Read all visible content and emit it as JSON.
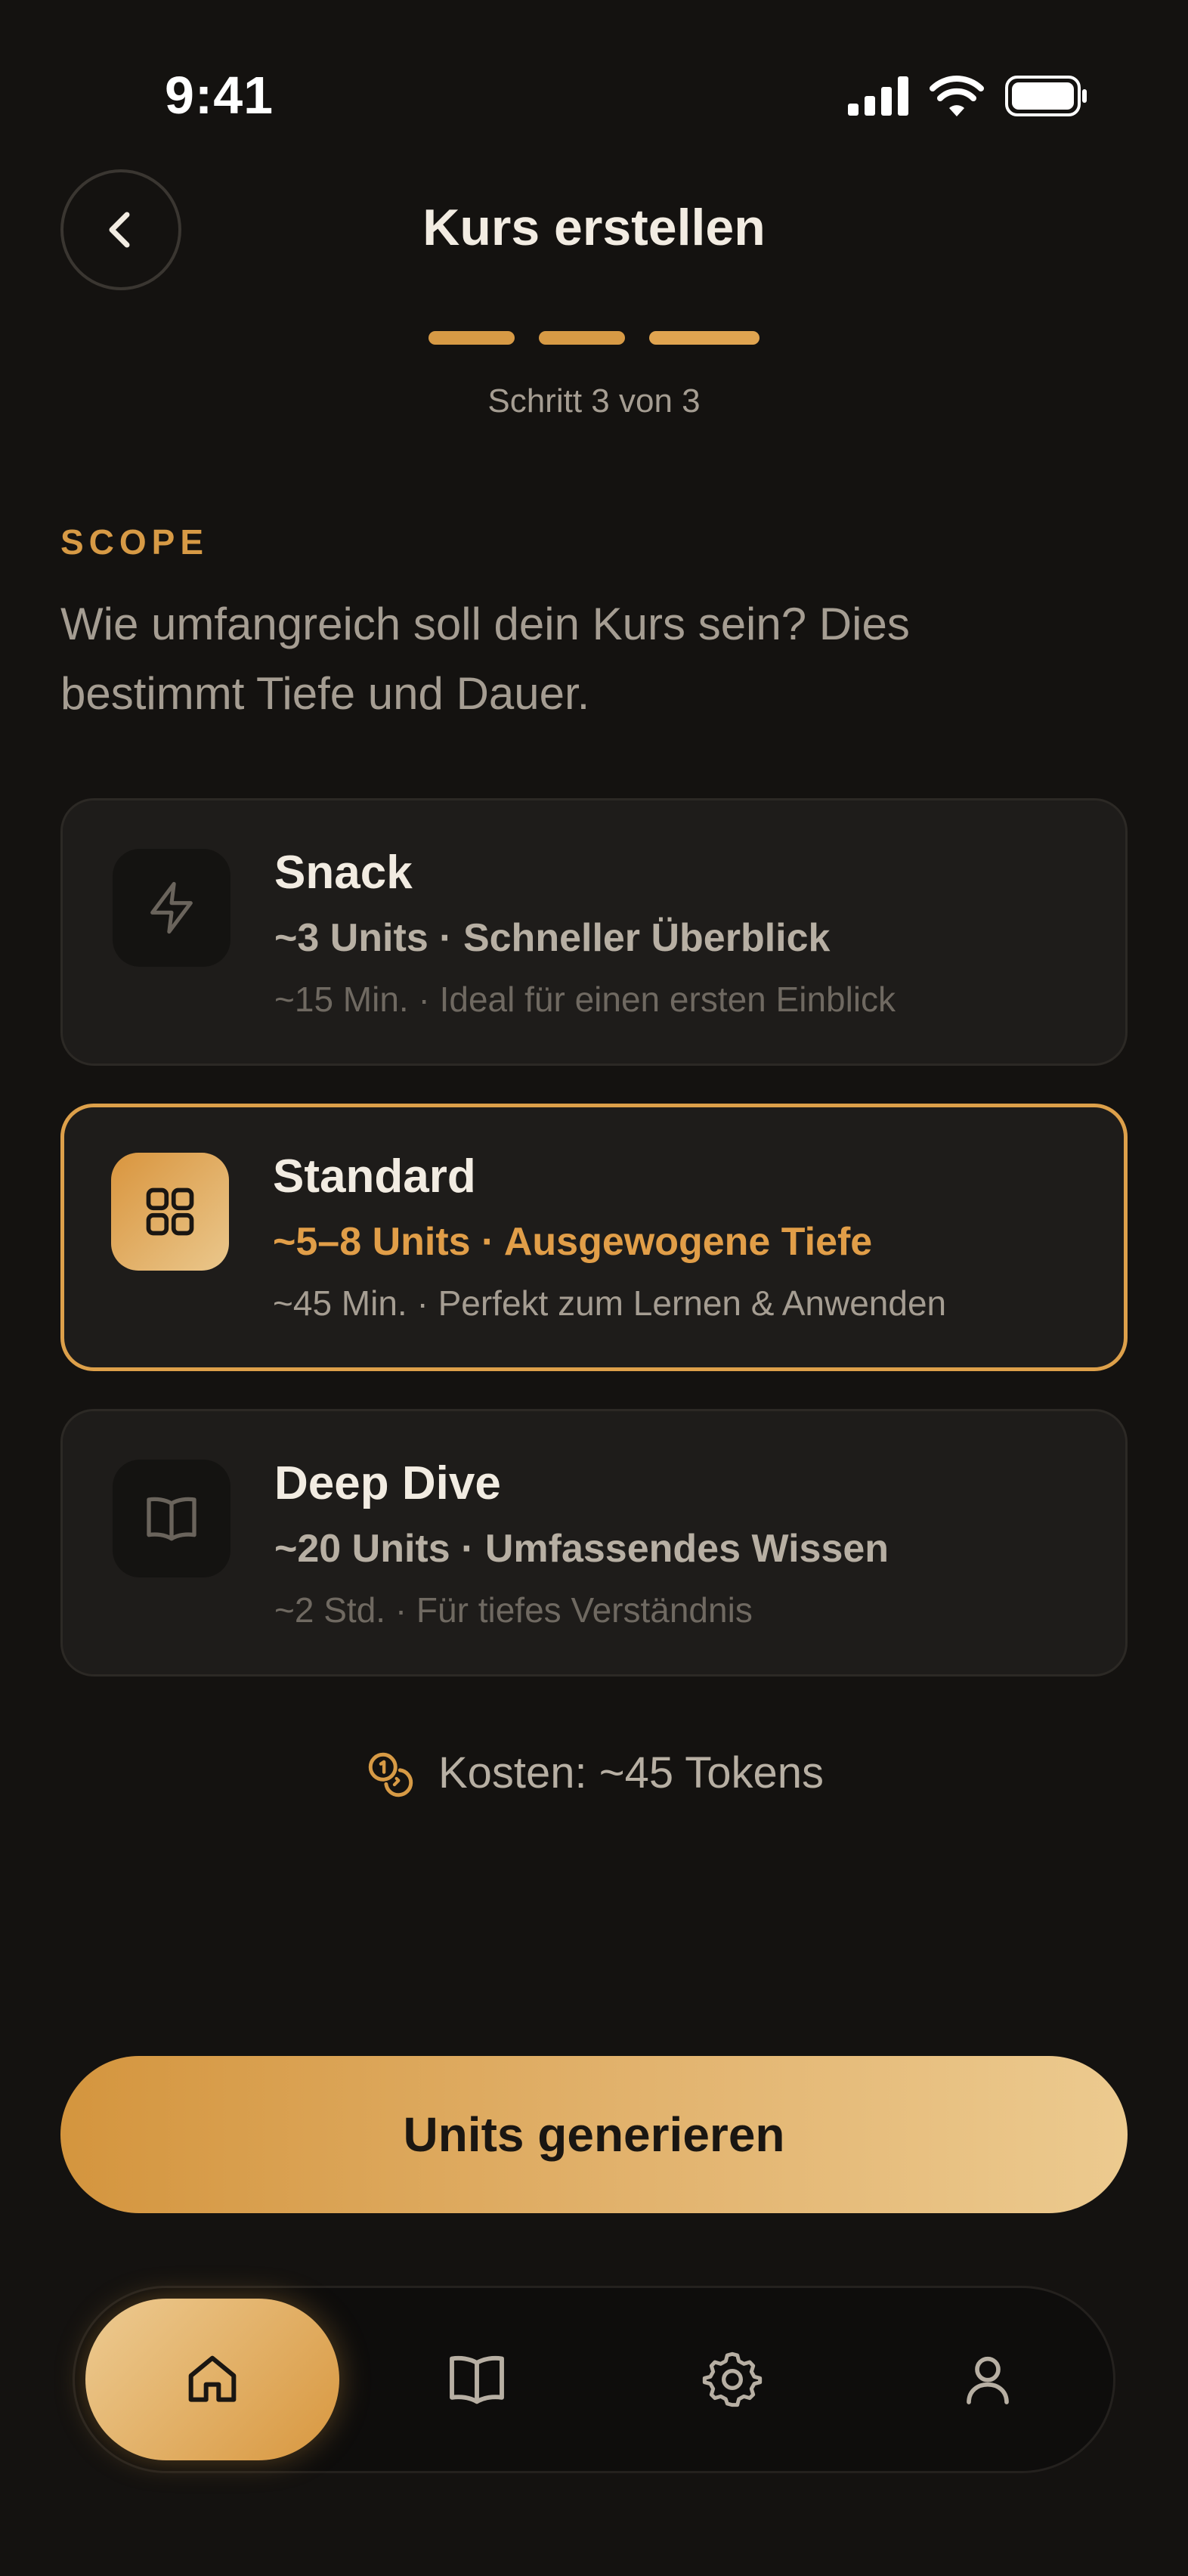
{
  "status_bar": {
    "time": "9:41"
  },
  "header": {
    "title": "Kurs erstellen",
    "step": "Schritt 3 von 3",
    "progress_current": 3,
    "progress_total": 3
  },
  "section": {
    "label": "SCOPE",
    "description": "Wie umfangreich soll dein Kurs sein? Dies bestimmt Tiefe und Dauer."
  },
  "options": [
    {
      "title": "Snack",
      "subtitle": "~3 Units · Schneller Überblick",
      "meta": "~15 Min. · Ideal für einen ersten Einblick",
      "icon": "lightning-icon",
      "selected": false
    },
    {
      "title": "Standard",
      "subtitle": "~5–8 Units · Ausgewogene Tiefe",
      "meta": "~45 Min. · Perfekt zum Lernen & Anwenden",
      "icon": "grid-icon",
      "selected": true
    },
    {
      "title": "Deep Dive",
      "subtitle": "~20 Units · Umfassendes Wissen",
      "meta": "~2 Std. · Für tiefes Verständnis",
      "icon": "book-open-icon",
      "selected": false
    }
  ],
  "cost": {
    "text": "Kosten: ~45 Tokens",
    "icon": "coins-icon"
  },
  "primary_button": {
    "label": "Units generieren"
  },
  "bottom_nav": {
    "items": [
      {
        "icon": "home-icon",
        "active": true
      },
      {
        "icon": "book-icon",
        "active": false
      },
      {
        "icon": "gear-icon",
        "active": false
      },
      {
        "icon": "user-icon",
        "active": false
      }
    ]
  },
  "colors": {
    "accent": "#D79A45",
    "background": "#141210",
    "card": "#1E1C1A",
    "text": "#F2ECE2",
    "muted": "#A59D92"
  }
}
